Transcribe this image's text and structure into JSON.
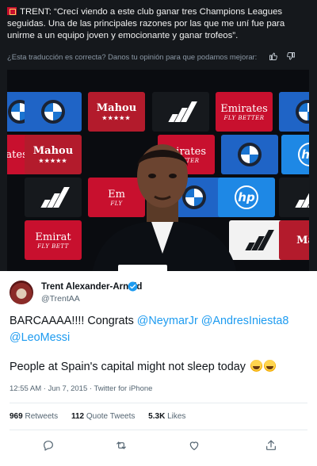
{
  "top_card": {
    "headline": "TRENT: “Crecí viendo a este club ganar tres Champions Leagues seguidas. Una de las principales razones por las que me uní fue para unirme a un equipo joven y emocionante y ganar trofeos”.",
    "feedback_question": "¿Esta traducción es correcta? Danos tu opinión para que podamos mejorar:",
    "icons": [
      "flag-icon",
      "thumbs-up-icon",
      "thumbs-down-icon"
    ]
  },
  "photo": {
    "sponsor_mahou": "Mahou",
    "sponsor_mahou_stars": "★★★★★",
    "sponsor_emirates": "Emirates",
    "sponsor_emirates_sub": "FLY BETTER",
    "sponsor_emirates_crop": "Emirat",
    "sponsor_emirates_sub_crop": "FLY BETT",
    "sponsor_mahou_crop": "Mahou",
    "sponsor_emirates_crop2": "mirates",
    "sponsor_emirates_sub_crop2": "BETTER",
    "sponsor_emirates_crop3": "Em",
    "sponsor_emirates_sub_crop3": "FLY",
    "sponsor_mahou_crop2": "Mal",
    "sponsor_hp": "hp",
    "colors": {
      "board_red": "#c8102e",
      "board_blue": "#1f64c6",
      "board_dark": "#16191d"
    }
  },
  "tweet": {
    "author_name": "Trent Alexander-Arnold",
    "handle": "@TrentAA",
    "text_prefix": "BARCAAAA!!!! Congrats ",
    "mention_1": "@NeymarJr",
    "mention_2": "@AndresIniesta8",
    "mention_3": "@LeoMessi",
    "text_line2": "People at Spain's capital might not sleep today",
    "timestamp": "12:55 AM · Jun 7, 2015 · Twitter for iPhone",
    "retweets_count": "969",
    "retweets_label": "Retweets",
    "quotes_count": "112",
    "quotes_label": "Quote Tweets",
    "likes_count": "5.3K",
    "likes_label": "Likes",
    "actions": [
      "reply-icon",
      "retweet-icon",
      "like-icon",
      "share-icon"
    ],
    "colors": {
      "link": "#1d9bf0",
      "muted": "#536471",
      "text": "#0f1419"
    }
  }
}
